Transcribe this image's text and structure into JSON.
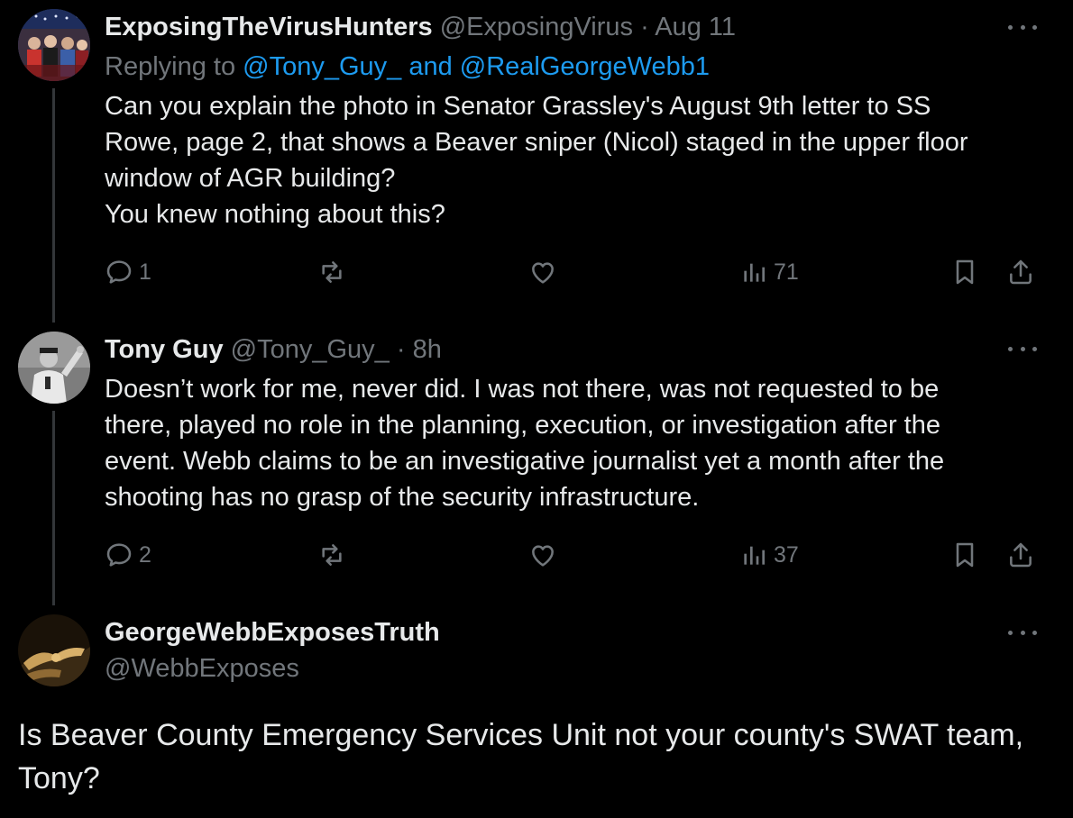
{
  "tweets": [
    {
      "display_name": "ExposingTheVirusHunters",
      "handle": "@ExposingVirus",
      "separator": "·",
      "time": "Aug 11",
      "replying_prefix": "Replying to",
      "replying_to": "@Tony_Guy_ and @RealGeorgeWebb1",
      "lines": [
        "Can you explain the photo in Senator Grassley's August 9th letter to SS",
        "Rowe, page 2, that shows a Beaver sniper (Nicol) staged in the upper floor",
        "window of AGR building?",
        "You knew nothing about this?"
      ],
      "replies": "1",
      "views": "71"
    },
    {
      "display_name": "Tony Guy",
      "handle": "@Tony_Guy_",
      "separator": "·",
      "time": "8h",
      "lines": [
        "Doesn’t work for me, never did. I was not there, was not requested to be",
        "there, played no role in the planning, execution, or investigation after the",
        "event. Webb claims to be an investigative journalist yet a month after the",
        "shooting has no grasp of the security infrastructure."
      ],
      "replies": "2",
      "views": "37"
    },
    {
      "display_name": "GeorgeWebbExposesTruth",
      "handle": "@WebbExposes",
      "lines": [
        "Is Beaver County Emergency Services Unit not your county's SWAT team,",
        "Tony?"
      ]
    }
  ],
  "icons": {
    "reply": "reply-icon",
    "retweet": "retweet-icon",
    "like": "like-icon",
    "views": "views-icon",
    "bookmark": "bookmark-icon",
    "share": "share-icon",
    "more": "more-icon"
  },
  "colors": {
    "background": "#000000",
    "text": "#e7e9ea",
    "muted": "#71767b",
    "link": "#1d9bf0"
  }
}
